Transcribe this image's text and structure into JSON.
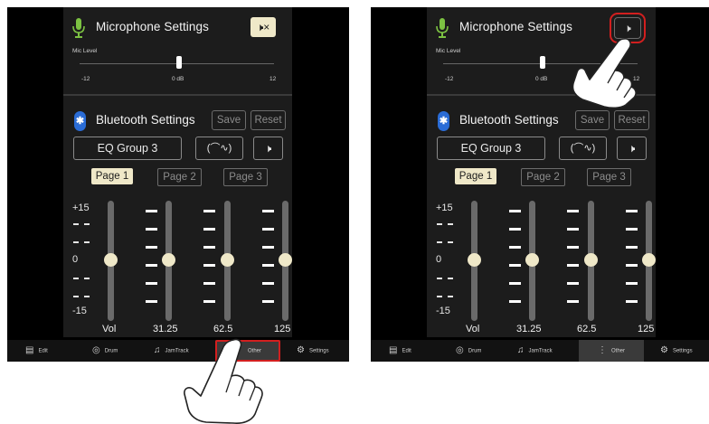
{
  "mic": {
    "title": "Microphone Settings",
    "mute_glyph": "🕨×",
    "unmute_glyph": "🕨",
    "level_label": "Mic Level",
    "ticks": {
      "min": "-12",
      "mid": "0 dB",
      "max": "12"
    }
  },
  "bt": {
    "icon": "✱",
    "title": "Bluetooth Settings",
    "save": "Save",
    "reset": "Reset",
    "eq_group": "EQ Group 3",
    "curve_glyph": "(⌒∿)",
    "speaker_glyph": "🕨"
  },
  "pages": [
    "Page 1",
    "Page 2",
    "Page 3"
  ],
  "scale": {
    "top": "+15",
    "mid": "0",
    "bottom": "-15"
  },
  "bands": [
    "Vol",
    "31.25",
    "62.5",
    "125"
  ],
  "nav": {
    "edit": "Edit",
    "drum": "Drum",
    "jamtrack": "JamTrack",
    "other": "Other",
    "settings": "Settings"
  },
  "colors": {
    "accent_cream": "#efe8c8",
    "highlight_red": "#d21f1f",
    "bluetooth_blue": "#2a6cd6",
    "mic_green": "#7cc242"
  }
}
